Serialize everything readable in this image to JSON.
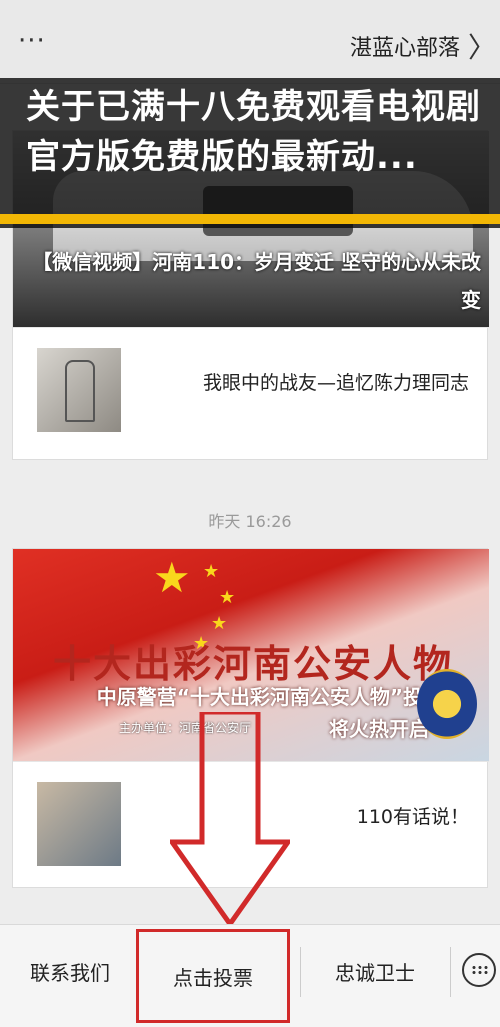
{
  "topbar": {
    "more_icon": "···",
    "name": "湛蓝心部落",
    "chevron": "〉"
  },
  "headline": {
    "text": "关于已满十八免费观看电视剧官方版免费版的最新动..."
  },
  "card1": {
    "image_caption": "【微信视频】河南110：岁月变迁 坚守的心从未改变",
    "item_title": "我眼中的战友—追忆陈力理同志"
  },
  "timestamp": "昨天 16:26",
  "card2": {
    "banner_big": "十大出彩河南公安人物",
    "banner_sub": "中原警营“十大出彩河南公安人物”投票即",
    "banner_org": "主办单位：河南省公安厅",
    "banner_open": "将火热开启",
    "item_title": "110有话说！"
  },
  "bottombar": {
    "tab1": "联系我们",
    "tab2": "点击投票",
    "tab3": "忠诚卫士"
  },
  "colors": {
    "highlight_box": "#d12a2a",
    "headline_bar": "#f2b705"
  },
  "icons": [
    "more-icon",
    "chevron-icon",
    "keyboard-icon",
    "down-arrow-icon",
    "star-icon"
  ]
}
